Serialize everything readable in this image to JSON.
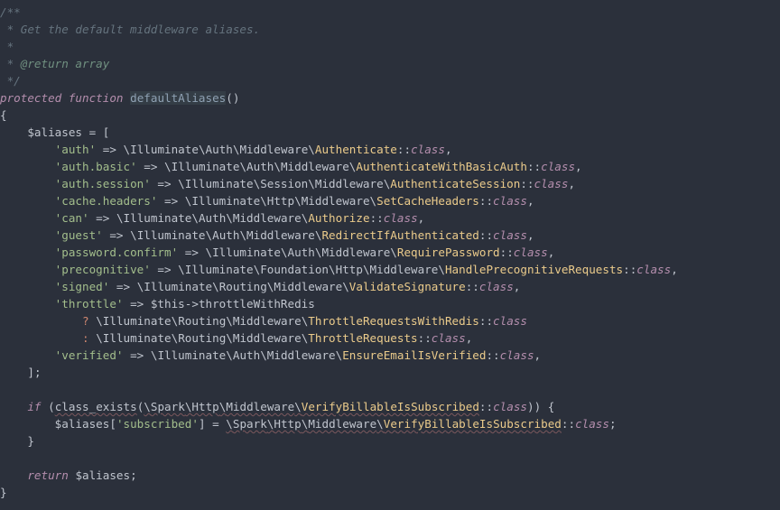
{
  "comment": {
    "l1": "/**",
    "l2": " * Get the default middleware aliases.",
    "l3": " *",
    "l4_star": " * ",
    "l4_tag": "@return array",
    "l5": " */"
  },
  "decl": {
    "protected": "protected",
    "function": "function",
    "name": "defaultAliases",
    "parens": "()"
  },
  "braces": {
    "open": "{",
    "close": "}",
    "sqopen": "[",
    "sqclose": "]",
    "semi": ";",
    "comma": ","
  },
  "assign": {
    "aliases_var": "$aliases",
    "eq": " = "
  },
  "arrow": " => ",
  "dblcolon": "::",
  "classkw": "class",
  "bs": "\\",
  "aliases": {
    "auth": {
      "key": "'auth'",
      "ns": [
        "Illuminate",
        "Auth",
        "Middleware"
      ],
      "cls": "Authenticate"
    },
    "auth_basic": {
      "key": "'auth.basic'",
      "ns": [
        "Illuminate",
        "Auth",
        "Middleware"
      ],
      "cls": "AuthenticateWithBasicAuth"
    },
    "auth_session": {
      "key": "'auth.session'",
      "ns": [
        "Illuminate",
        "Session",
        "Middleware"
      ],
      "cls": "AuthenticateSession"
    },
    "cache_headers": {
      "key": "'cache.headers'",
      "ns": [
        "Illuminate",
        "Http",
        "Middleware"
      ],
      "cls": "SetCacheHeaders"
    },
    "can": {
      "key": "'can'",
      "ns": [
        "Illuminate",
        "Auth",
        "Middleware"
      ],
      "cls": "Authorize"
    },
    "guest": {
      "key": "'guest'",
      "ns": [
        "Illuminate",
        "Auth",
        "Middleware"
      ],
      "cls": "RedirectIfAuthenticated"
    },
    "password_confirm": {
      "key": "'password.confirm'",
      "ns": [
        "Illuminate",
        "Auth",
        "Middleware"
      ],
      "cls": "RequirePassword"
    },
    "precognitive": {
      "key": "'precognitive'",
      "ns": [
        "Illuminate",
        "Foundation",
        "Http",
        "Middleware"
      ],
      "cls": "HandlePrecognitiveRequests"
    },
    "signed": {
      "key": "'signed'",
      "ns": [
        "Illuminate",
        "Routing",
        "Middleware"
      ],
      "cls": "ValidateSignature"
    },
    "throttle": {
      "key": "'throttle'",
      "this": "$this",
      "arrow_obj": "->",
      "prop": "throttleWithRedis",
      "redis_ns": [
        "Illuminate",
        "Routing",
        "Middleware"
      ],
      "redis_cls": "ThrottleRequestsWithRedis",
      "plain_ns": [
        "Illuminate",
        "Routing",
        "Middleware"
      ],
      "plain_cls": "ThrottleRequests",
      "q": "?",
      "c": ":"
    },
    "verified": {
      "key": "'verified'",
      "ns": [
        "Illuminate",
        "Auth",
        "Middleware"
      ],
      "cls": "EnsureEmailIsVerified"
    }
  },
  "if_block": {
    "if": "if",
    "fn": "class_exists",
    "chk_ns": [
      "Spark",
      "Http",
      "Middleware"
    ],
    "chk_cls": "VerifyBillableIsSubscribed",
    "key": "'subscribed'",
    "assign_ns": [
      "Spark",
      "Http",
      "Middleware"
    ],
    "assign_cls": "VerifyBillableIsSubscribed",
    "open_sq": "[",
    "close_sq": "]"
  },
  "return": {
    "kw": "return",
    "var": "$aliases"
  }
}
